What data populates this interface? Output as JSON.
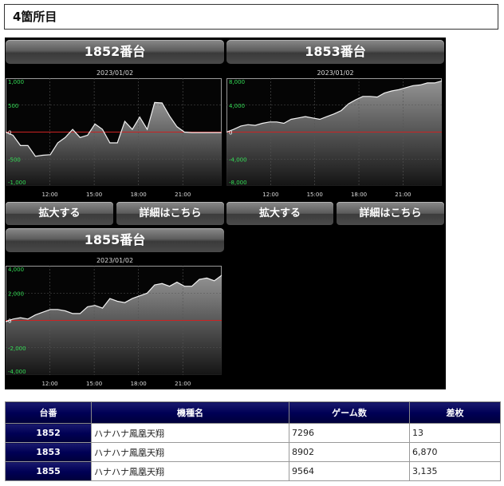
{
  "section_title": "4箇所目",
  "units": [
    {
      "title": "1852番台",
      "date": "2023/01/02",
      "y_ticks": [
        "1,000",
        "500",
        "0",
        "-500",
        "-1,000"
      ],
      "x_ticks": [
        "12:00",
        "15:00",
        "18:00",
        "21:00"
      ],
      "expand_label": "拡大する",
      "detail_label": "詳細はこちら"
    },
    {
      "title": "1853番台",
      "date": "2023/01/02",
      "y_ticks": [
        "8,000",
        "4,000",
        "0",
        "-4,000",
        "-8,000"
      ],
      "x_ticks": [
        "12:00",
        "15:00",
        "18:00",
        "21:00"
      ],
      "expand_label": "拡大する",
      "detail_label": "詳細はこちら"
    },
    {
      "title": "1855番台",
      "date": "2023/01/02",
      "y_ticks": [
        "4,000",
        "2,000",
        "0",
        "-2,000",
        "-4,000"
      ],
      "x_ticks": [
        "12:00",
        "15:00",
        "18:00",
        "21:00"
      ]
    }
  ],
  "table": {
    "headers": [
      "台番",
      "機種名",
      "ゲーム数",
      "差枚"
    ],
    "rows": [
      [
        "1852",
        "ハナハナ鳳凰天翔",
        "7296",
        "13"
      ],
      [
        "1853",
        "ハナハナ鳳凰天翔",
        "8902",
        "6,870"
      ],
      [
        "1855",
        "ハナハナ鳳凰天翔",
        "9564",
        "3,135"
      ]
    ]
  },
  "chart_data": [
    {
      "type": "area",
      "title": "2023/01/02",
      "ylim": [
        -1000,
        1000
      ],
      "x_ticks": [
        "12:00",
        "15:00",
        "18:00",
        "21:00"
      ],
      "series": [
        {
          "values": [
            0,
            -60,
            -250,
            -250,
            -450,
            -430,
            -420,
            -200,
            -100,
            50,
            -100,
            -60,
            150,
            50,
            -200,
            -200,
            200,
            50,
            280,
            50,
            550,
            540,
            300,
            100,
            0,
            -10,
            -10,
            -10,
            -10,
            -10
          ]
        }
      ]
    },
    {
      "type": "area",
      "title": "2023/01/02",
      "ylim": [
        -8000,
        8000
      ],
      "x_ticks": [
        "12:00",
        "15:00",
        "18:00",
        "21:00"
      ],
      "series": [
        {
          "values": [
            0,
            400,
            900,
            1100,
            1000,
            1300,
            1500,
            1500,
            1300,
            1900,
            2100,
            2300,
            2100,
            1900,
            2300,
            2700,
            3200,
            4200,
            4800,
            5300,
            5300,
            5200,
            5800,
            6100,
            6300,
            6600,
            6900,
            7000,
            7300,
            7300,
            7600
          ]
        }
      ]
    },
    {
      "type": "area",
      "title": "2023/01/02",
      "ylim": [
        -4000,
        4000
      ],
      "x_ticks": [
        "12:00",
        "15:00",
        "18:00",
        "21:00"
      ],
      "series": [
        {
          "values": [
            -100,
            100,
            200,
            100,
            400,
            600,
            800,
            800,
            700,
            500,
            500,
            1000,
            1100,
            900,
            1600,
            1400,
            1300,
            1600,
            1800,
            2000,
            2600,
            2700,
            2500,
            2800,
            2500,
            2500,
            3000,
            3100,
            2900,
            3300
          ]
        }
      ]
    }
  ]
}
